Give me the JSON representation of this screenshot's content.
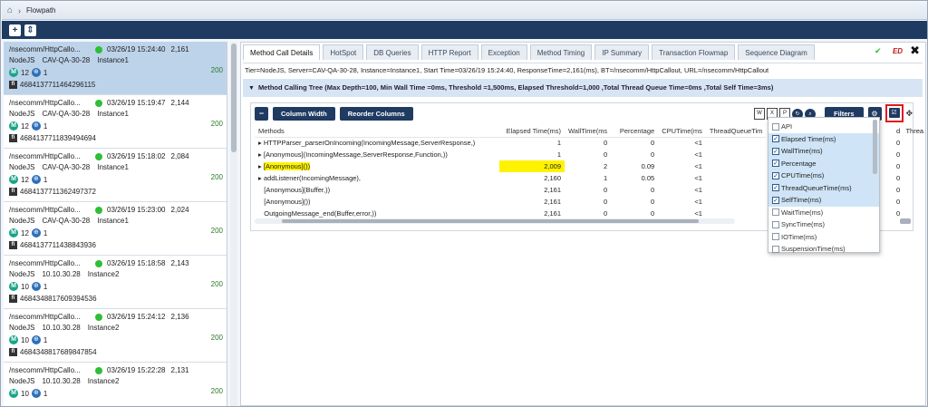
{
  "breadcrumb": {
    "section": "Flowpath"
  },
  "toolbar": {
    "add_symbol": "+",
    "more_symbol": "⇕"
  },
  "flowpaths": [
    {
      "url": "/nsecomm/HttpCallo...",
      "time": "03/26/19 15:24:40",
      "duration": "2,161",
      "type": "NodeJS",
      "server": "CAV-QA-30-28",
      "instance": "Instance1",
      "methods": "12",
      "threads": "1",
      "count": "200",
      "id": "4684137711464296115",
      "selected": true
    },
    {
      "url": "/nsecomm/HttpCallo...",
      "time": "03/26/19 15:19:47",
      "duration": "2,144",
      "type": "NodeJS",
      "server": "CAV-QA-30-28",
      "instance": "Instance1",
      "methods": "12",
      "threads": "1",
      "count": "200",
      "id": "4684137711839494694"
    },
    {
      "url": "/nsecomm/HttpCallo...",
      "time": "03/26/19 15:18:02",
      "duration": "2,084",
      "type": "NodeJS",
      "server": "CAV-QA-30-28",
      "instance": "Instance1",
      "methods": "12",
      "threads": "1",
      "count": "200",
      "id": "4684137711362497372"
    },
    {
      "url": "/nsecomm/HttpCallo...",
      "time": "03/26/19 15:23:00",
      "duration": "2,024",
      "type": "NodeJS",
      "server": "CAV-QA-30-28",
      "instance": "Instance1",
      "methods": "12",
      "threads": "1",
      "count": "200",
      "id": "4684137711438843936"
    },
    {
      "url": "/nsecomm/HttpCallo...",
      "time": "03/26/19 15:18:58",
      "duration": "2,143",
      "type": "NodeJS",
      "server": "10.10.30.28",
      "instance": "Instance2",
      "methods": "10",
      "threads": "1",
      "count": "200",
      "id": "4684348817609394536"
    },
    {
      "url": "/nsecomm/HttpCallo...",
      "time": "03/26/19 15:24:12",
      "duration": "2,136",
      "type": "NodeJS",
      "server": "10.10.30.28",
      "instance": "Instance2",
      "methods": "10",
      "threads": "1",
      "count": "200",
      "id": "4684348817689847854"
    },
    {
      "url": "/nsecomm/HttpCallo...",
      "time": "03/26/19 15:22:28",
      "duration": "2,131",
      "type": "NodeJS",
      "server": "10.10.30.28",
      "instance": "Instance2",
      "methods": "10",
      "threads": "1",
      "count": "200",
      "id": ""
    }
  ],
  "tabs": [
    "Method Call Details",
    "HotSpot",
    "DB Queries",
    "HTTP Report",
    "Exception",
    "Method Timing",
    "IP Summary",
    "Transaction Flowmap",
    "Sequence Diagram"
  ],
  "active_tab": "Method Call Details",
  "header_icons": {
    "ed_label": "ED",
    "close": "✖"
  },
  "info_line": "Tier=NodeJS, Server=CAV-QA-30-28, Instance=Instance1, Start Time=03/26/19 15:24:40, ResponseTime=2,161(ms), BT=/nsecomm/HttpCallout, URL=/nsecomm/HttpCallout",
  "tree_title": "Method Calling Tree (Max Depth=100, Min Wall Time =0ms, Threshold =1,500ms, Elapsed Threshold=1,000 ,Total Thread Queue Time=0ms ,Total Self Time=3ms)",
  "buttons": {
    "collapse": "−",
    "column_width": "Column Width",
    "reorder_columns": "Reorder Columns",
    "filters": "Filters"
  },
  "table": {
    "headers": [
      "Methods",
      "Elapsed Time(ms)",
      "WallTime(ms",
      "Percentage",
      "CPUTime(ms",
      "ThreadQueueTim"
    ],
    "extra_headers": [
      "d",
      "Threa"
    ],
    "rows": [
      {
        "method": "HTTPParser_parserOnIncoming(IncomingMessage,ServerResponse,)",
        "expandable": true,
        "elapsed": "1",
        "wall": "0",
        "pct": "0",
        "cpu": "<1",
        "extra": "0"
      },
      {
        "method": "[Anonymous](IncomingMessage,ServerResponse,Function,))",
        "expandable": true,
        "elapsed": "1",
        "wall": "0",
        "pct": "0",
        "cpu": "<1",
        "extra": "0"
      },
      {
        "method": "[Anonymous]())",
        "expandable": true,
        "elapsed": "2,009",
        "wall": "2",
        "pct": "0.09",
        "cpu": "<1",
        "extra": "0",
        "highlight": true
      },
      {
        "method": "addListener(IncomingMessage),",
        "expandable": true,
        "elapsed": "2,160",
        "wall": "1",
        "pct": "0.05",
        "cpu": "<1",
        "extra": "0"
      },
      {
        "method": "[Anonymous](Buffer,))",
        "expandable": false,
        "elapsed": "2,161",
        "wall": "0",
        "pct": "0",
        "cpu": "<1",
        "extra": "0"
      },
      {
        "method": "[Anonymous]())",
        "expandable": false,
        "elapsed": "2,161",
        "wall": "0",
        "pct": "0",
        "cpu": "<1",
        "extra": "0"
      },
      {
        "method": "OutgoingMessage_end(Buffer,error,))",
        "expandable": false,
        "elapsed": "2,161",
        "wall": "0",
        "pct": "0",
        "cpu": "<1",
        "extra": "0"
      }
    ]
  },
  "column_chooser": [
    {
      "label": "API",
      "checked": false
    },
    {
      "label": "Elapsed Time(ms)",
      "checked": true
    },
    {
      "label": "WallTime(ms)",
      "checked": true
    },
    {
      "label": "Percentage",
      "checked": true
    },
    {
      "label": "CPUTime(ms)",
      "checked": true
    },
    {
      "label": "ThreadQueueTime(ms)",
      "checked": true
    },
    {
      "label": "SelfTime(ms)",
      "checked": true
    },
    {
      "label": "WaitTime(ms)",
      "checked": false
    },
    {
      "label": "SyncTime(ms)",
      "checked": false
    },
    {
      "label": "IOTime(ms)",
      "checked": false
    },
    {
      "label": "SuspensionTime(ms)",
      "checked": false
    }
  ],
  "colors": {
    "navy": "#1f3b61",
    "selected_row": "#bdd3ea",
    "highlight": "#fff200",
    "status_green": "#2fbe36",
    "chooser_border": "#e01b1b"
  }
}
